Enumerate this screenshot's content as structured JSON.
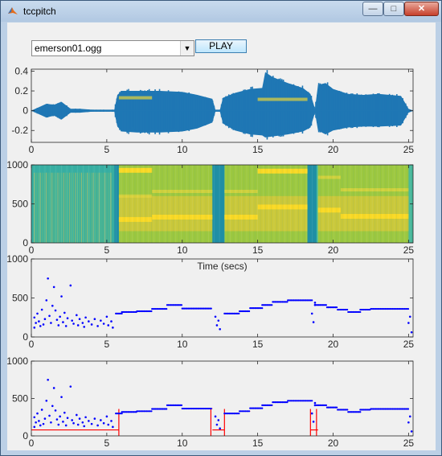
{
  "window": {
    "title": "tccpitch"
  },
  "controls": {
    "file_value": "emerson01.ogg",
    "play_label": "PLAY"
  },
  "colors": {
    "waveform": "#1f77b4",
    "pitch_dots": "#0000ff",
    "smoothed_track": "#ff0000"
  },
  "chart_data": [
    {
      "type": "area",
      "name": "waveform",
      "xlim": [
        0,
        25.3
      ],
      "ylim": [
        -0.32,
        0.42
      ],
      "xticks": [
        "0",
        "5",
        "10",
        "15",
        "20",
        "25"
      ],
      "yticks": [
        "0.4",
        "0.2",
        "0",
        "-0.2"
      ],
      "ytick_values": [
        0.4,
        0.2,
        0,
        -0.2
      ],
      "envelope": {
        "x": [
          0,
          1.0,
          1.5,
          2.0,
          2.6,
          3.2,
          4.0,
          5.0,
          5.5,
          5.7,
          6.0,
          7.0,
          8.5,
          10.0,
          11.0,
          12.0,
          12.2,
          12.5,
          12.7,
          13.5,
          14.5,
          15.3,
          15.5,
          16.0,
          17.0,
          18.0,
          18.5,
          18.8,
          19.0,
          19.5,
          20.0,
          21.0,
          22.0,
          23.0,
          24.5,
          25.0,
          25.3
        ],
        "top": [
          0,
          0.07,
          0.06,
          0.09,
          0.02,
          0.02,
          0.01,
          0.01,
          0.01,
          0.16,
          0.2,
          0.2,
          0.2,
          0.19,
          0.16,
          0.12,
          0.01,
          0.01,
          0.13,
          0.18,
          0.22,
          0.23,
          0.39,
          0.34,
          0.28,
          0.23,
          0.17,
          0.02,
          0.26,
          0.28,
          0.22,
          0.17,
          0.16,
          0.17,
          0.15,
          0.02,
          0
        ],
        "bottom": [
          0,
          -0.07,
          -0.05,
          -0.09,
          -0.02,
          -0.02,
          -0.01,
          -0.01,
          -0.01,
          -0.16,
          -0.21,
          -0.22,
          -0.22,
          -0.21,
          -0.18,
          -0.12,
          -0.01,
          -0.01,
          -0.13,
          -0.2,
          -0.24,
          -0.25,
          -0.27,
          -0.26,
          -0.24,
          -0.21,
          -0.17,
          -0.02,
          -0.2,
          -0.24,
          -0.2,
          -0.17,
          -0.16,
          -0.16,
          -0.15,
          -0.02,
          0
        ]
      }
    },
    {
      "type": "heatmap",
      "name": "spectrogram",
      "xlim": [
        0,
        25.3
      ],
      "ylim": [
        0,
        1000
      ],
      "xticks": [
        "0",
        "5",
        "10",
        "15",
        "20",
        "25"
      ],
      "yticks": [
        "1000",
        "500",
        "0"
      ],
      "ytick_values": [
        1000,
        500,
        0
      ],
      "xlabel": "Time (secs)",
      "bright_segments": [
        {
          "x0": 5.8,
          "x1": 8.0,
          "y": 300
        },
        {
          "x0": 8.0,
          "x1": 12.0,
          "y": 330
        },
        {
          "x0": 12.8,
          "x1": 15.0,
          "y": 330
        },
        {
          "x0": 15.0,
          "x1": 18.3,
          "y": 460
        },
        {
          "x0": 19.0,
          "x1": 20.5,
          "y": 420
        },
        {
          "x0": 20.5,
          "x1": 25.0,
          "y": 340
        },
        {
          "x0": 5.8,
          "x1": 8.0,
          "y": 930
        },
        {
          "x0": 15.0,
          "x1": 18.3,
          "y": 920
        }
      ]
    },
    {
      "type": "scatter",
      "name": "raw-pitch",
      "xlim": [
        0,
        25.3
      ],
      "ylim": [
        0,
        1000
      ],
      "xticks": [
        "0",
        "5",
        "10",
        "15",
        "20",
        "25"
      ],
      "yticks": [
        "1000",
        "500",
        "0"
      ],
      "ytick_values": [
        1000,
        500,
        0
      ],
      "steps": [
        [
          5.6,
          6.0,
          300
        ],
        [
          6.0,
          7.0,
          320
        ],
        [
          7.0,
          8.0,
          330
        ],
        [
          8.0,
          9.0,
          360
        ],
        [
          9.0,
          10.0,
          410
        ],
        [
          10.0,
          12.0,
          365
        ],
        [
          12.8,
          13.8,
          300
        ],
        [
          13.8,
          14.5,
          330
        ],
        [
          14.5,
          15.3,
          370
        ],
        [
          15.3,
          16.0,
          410
        ],
        [
          16.0,
          17.0,
          450
        ],
        [
          17.0,
          18.6,
          470
        ],
        [
          18.9,
          19.6,
          410
        ],
        [
          19.6,
          20.3,
          380
        ],
        [
          20.3,
          21.0,
          350
        ],
        [
          21.0,
          21.8,
          320
        ],
        [
          21.8,
          22.5,
          350
        ],
        [
          22.5,
          25.0,
          360
        ]
      ],
      "scatter": [
        [
          0.2,
          120
        ],
        [
          0.2,
          250
        ],
        [
          0.3,
          180
        ],
        [
          0.4,
          300
        ],
        [
          0.5,
          200
        ],
        [
          0.6,
          140
        ],
        [
          0.7,
          350
        ],
        [
          0.8,
          160
        ],
        [
          0.9,
          230
        ],
        [
          1.0,
          470
        ],
        [
          1.1,
          750
        ],
        [
          1.2,
          270
        ],
        [
          1.3,
          180
        ],
        [
          1.4,
          400
        ],
        [
          1.5,
          640
        ],
        [
          1.6,
          340
        ],
        [
          1.7,
          220
        ],
        [
          1.8,
          150
        ],
        [
          1.9,
          260
        ],
        [
          2.0,
          520
        ],
        [
          2.1,
          190
        ],
        [
          2.2,
          310
        ],
        [
          2.3,
          140
        ],
        [
          2.4,
          240
        ],
        [
          2.6,
          660
        ],
        [
          2.7,
          210
        ],
        [
          2.8,
          170
        ],
        [
          3.0,
          280
        ],
        [
          3.1,
          150
        ],
        [
          3.2,
          230
        ],
        [
          3.4,
          180
        ],
        [
          3.5,
          130
        ],
        [
          3.6,
          250
        ],
        [
          3.8,
          200
        ],
        [
          4.0,
          160
        ],
        [
          4.2,
          230
        ],
        [
          4.4,
          140
        ],
        [
          4.6,
          210
        ],
        [
          4.8,
          170
        ],
        [
          5.0,
          260
        ],
        [
          5.1,
          150
        ],
        [
          5.3,
          200
        ],
        [
          5.4,
          120
        ],
        [
          12.2,
          260
        ],
        [
          12.3,
          150
        ],
        [
          12.4,
          210
        ],
        [
          12.5,
          100
        ],
        [
          18.6,
          300
        ],
        [
          18.7,
          190
        ],
        [
          18.8,
          410
        ],
        [
          18.8,
          440
        ],
        [
          25.0,
          180
        ],
        [
          25.1,
          260
        ],
        [
          25.2,
          60
        ]
      ]
    },
    {
      "type": "scatter",
      "name": "smoothed-pitch",
      "xlim": [
        0,
        25.3
      ],
      "ylim": [
        0,
        1000
      ],
      "xticks": [
        "0",
        "5",
        "10",
        "15",
        "20",
        "25"
      ],
      "yticks": [
        "1000",
        "500",
        "0"
      ],
      "ytick_values": [
        1000,
        500,
        0
      ],
      "red_baseline": 80,
      "red_segments": [
        [
          0,
          5.8
        ],
        [
          12.0,
          12.8
        ],
        [
          18.5,
          19.0
        ]
      ],
      "drops": [
        5.8,
        11.9,
        12.8,
        18.5,
        18.9
      ]
    }
  ]
}
